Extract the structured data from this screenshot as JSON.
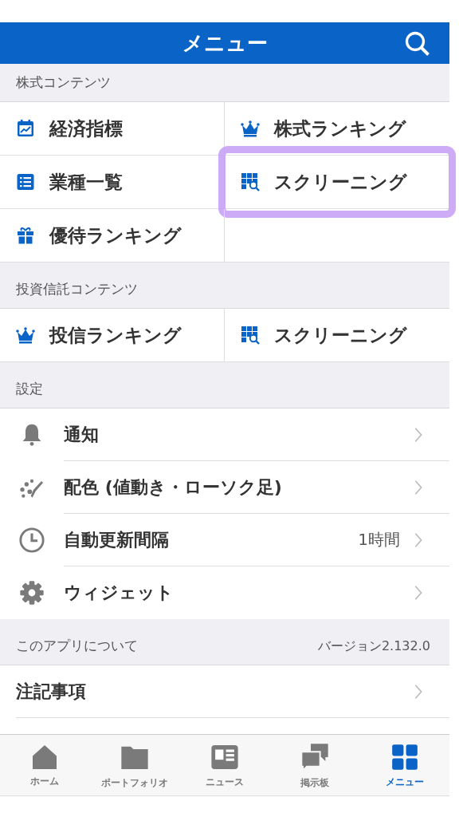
{
  "header": {
    "title": "メニュー"
  },
  "sections": [
    {
      "kind": "grid",
      "title": "株式コンテンツ",
      "items": [
        {
          "label": "経済指標",
          "kind": "calendar",
          "highlighted": false
        },
        {
          "label": "株式ランキング",
          "kind": "crown",
          "highlighted": false
        },
        {
          "label": "業種一覧",
          "kind": "list",
          "highlighted": false
        },
        {
          "label": "スクリーニング",
          "kind": "screening",
          "highlighted": true
        },
        {
          "label": "優待ランキング",
          "kind": "gift",
          "highlighted": false
        }
      ]
    },
    {
      "kind": "grid",
      "title": "投資信託コンテンツ",
      "items": [
        {
          "label": "投信ランキング",
          "kind": "crown",
          "highlighted": false
        },
        {
          "label": "スクリーニング",
          "kind": "screening",
          "highlighted": false
        }
      ]
    },
    {
      "kind": "settings",
      "title": "設定",
      "items": [
        {
          "label": "通知",
          "kind": "bell"
        },
        {
          "label": "配色 (値動き・ローソク足)",
          "kind": "paint"
        },
        {
          "label": "自動更新間隔",
          "kind": "clock",
          "value": "1時間"
        },
        {
          "label": "ウィジェット",
          "kind": "gear"
        }
      ]
    },
    {
      "kind": "plain",
      "title": "このアプリについて",
      "note": "バージョン2.132.0",
      "items": [
        {
          "label": "注記事項"
        }
      ]
    }
  ],
  "tabs": [
    {
      "label": "ホーム",
      "kind": "home",
      "selected": false
    },
    {
      "label": "ポートフォリオ",
      "kind": "folder",
      "selected": false
    },
    {
      "label": "ニュース",
      "kind": "news",
      "selected": false
    },
    {
      "label": "掲示板",
      "kind": "chat",
      "selected": false
    },
    {
      "label": "メニュー",
      "kind": "grid",
      "selected": true
    }
  ]
}
